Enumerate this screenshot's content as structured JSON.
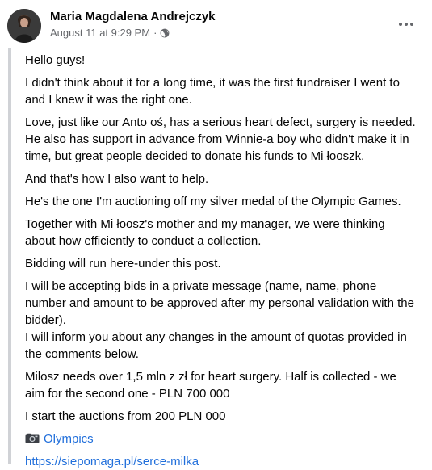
{
  "author": {
    "name": "Maria Magdalena Andrejczyk"
  },
  "meta": {
    "date": "August 11 at 9:29 PM",
    "separator": "·",
    "privacy_icon": "globe-icon"
  },
  "more_icon": "more-options-icon",
  "paragraphs": [
    "Hello guys!",
    "I didn't think about it for a long time, it was the first fundraiser I went to and I knew it was the right one.",
    "Love, just like our Anto oś, has a serious heart defect, surgery is needed. He also has support in advance from Winnie-a boy who didn't make it in time, but great people decided to donate his funds to Mi łooszk.",
    "And that's how I also want to help.",
    "He's the one I'm auctioning off my silver medal of the Olympic Games.",
    "Together with Mi łoosz's mother and my manager, we were thinking about how efficiently to conduct a collection.",
    "Bidding will run here-under this post.",
    "I will be accepting bids in a private message (name, name, phone number and amount to be approved after my personal validation with the bidder).",
    "I will inform you about any changes in the amount of quotas provided in the comments below.",
    "Milosz needs over 1,5 mln z zł for heart surgery. Half is collected - we aim for the second one - PLN 700 000",
    "I start the auctions from 200 PLN 000"
  ],
  "hashtag": {
    "icon": "camera-icon",
    "label": "Olympics"
  },
  "link": {
    "url": "https://siepomaga.pl/serce-milka"
  },
  "colors": {
    "link": "#216fdb",
    "meta": "#65676b",
    "quote_bar": "#d0d2d6"
  }
}
